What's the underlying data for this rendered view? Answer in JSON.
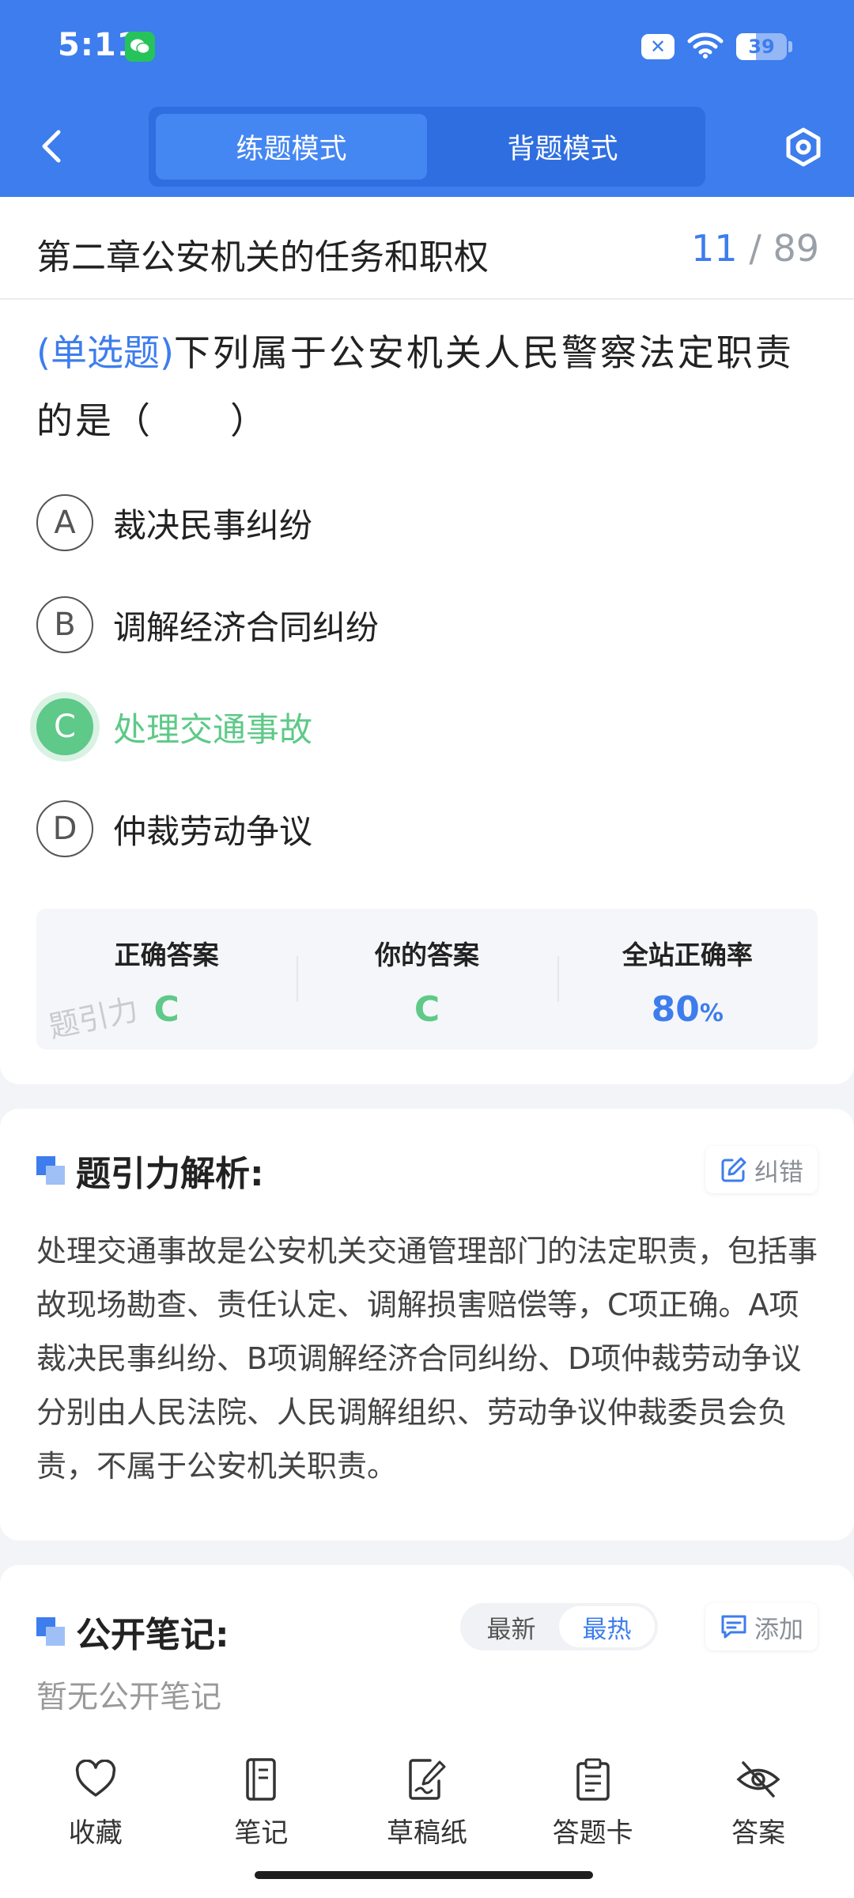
{
  "status_bar": {
    "time": "5:11",
    "battery": "39",
    "battery_level_percent": 39
  },
  "header": {
    "tabs": [
      {
        "label": "练题模式",
        "active": true
      },
      {
        "label": "背题模式",
        "active": false
      }
    ]
  },
  "chapter": {
    "title": "第二章公安机关的任务和职权",
    "current": "11",
    "total": "89"
  },
  "question": {
    "type": "(单选题)",
    "text": "下列属于公安机关人民警察法定职责的是（　　）",
    "options": [
      {
        "letter": "A",
        "text": "裁决民事纠纷"
      },
      {
        "letter": "B",
        "text": "调解经济合同纠纷"
      },
      {
        "letter": "C",
        "text": "处理交通事故"
      },
      {
        "letter": "D",
        "text": "仲裁劳动争议"
      }
    ]
  },
  "answers": {
    "correct_label": "正确答案",
    "correct_value": "C",
    "yours_label": "你的答案",
    "yours_value": "C",
    "rate_label": "全站正确率",
    "rate_value": "80",
    "rate_unit": "%",
    "watermark": "题引力"
  },
  "analysis": {
    "title": "题引力解析:",
    "report_label": "纠错",
    "text": "处理交通事故是公安机关交通管理部门的法定职责，包括事故现场勘查、责任认定、调解损害赔偿等，C项正确。A项裁决民事纠纷、B项调解经济合同纠纷、D项仲裁劳动争议分别由人民法院、人民调解组织、劳动争议仲裁委员会负责，不属于公安机关职责。"
  },
  "notes": {
    "title": "公开笔记:",
    "sort_options": [
      "最新",
      "最热"
    ],
    "add_label": "添加",
    "empty_text": "暂无公开笔记"
  },
  "bottom_nav": [
    {
      "label": "收藏",
      "icon": "heart-icon"
    },
    {
      "label": "笔记",
      "icon": "notebook-icon"
    },
    {
      "label": "草稿纸",
      "icon": "draft-pen-icon"
    },
    {
      "label": "答题卡",
      "icon": "clipboard-icon"
    },
    {
      "label": "答案",
      "icon": "eye-off-icon"
    }
  ],
  "colors": {
    "primary": "#3d7ded",
    "correct": "#5ec988"
  }
}
